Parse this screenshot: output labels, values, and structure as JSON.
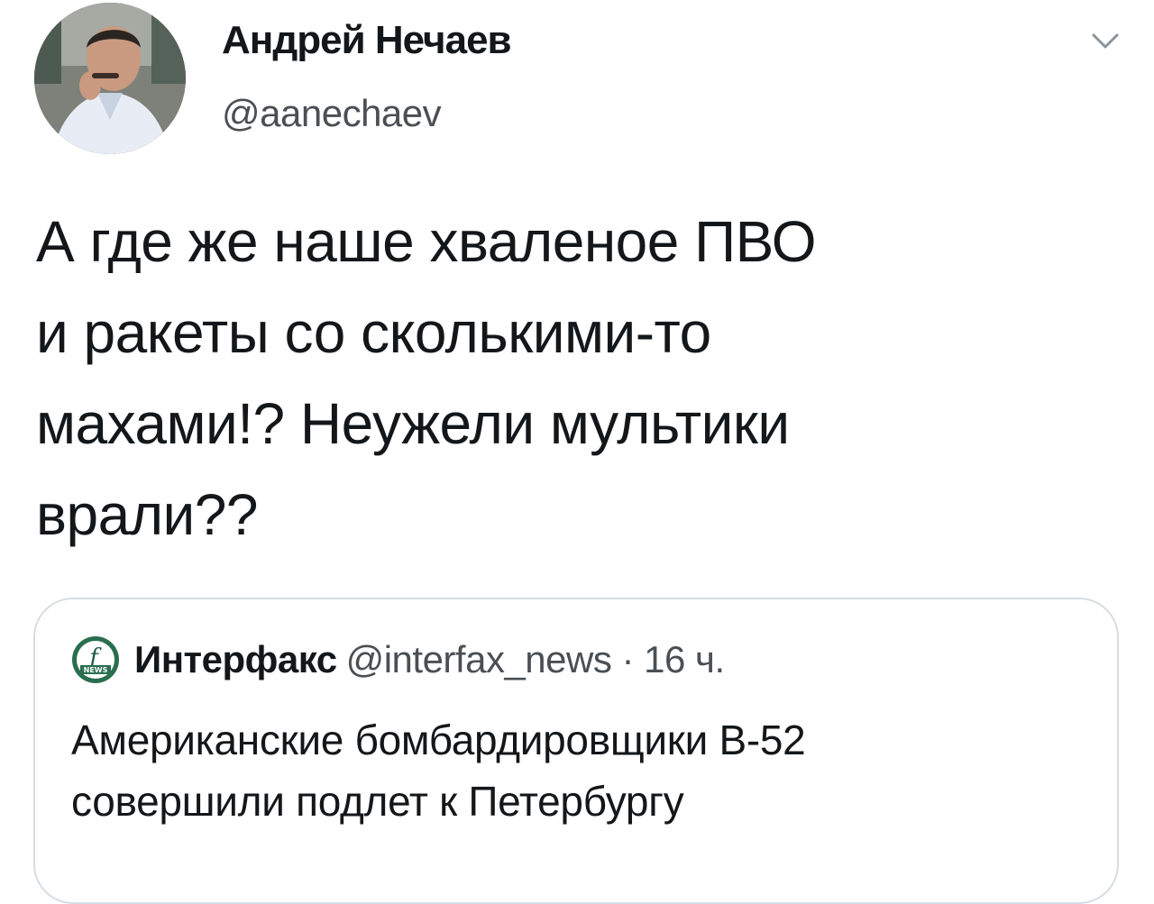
{
  "tweet": {
    "author": {
      "display_name": "Андрей Нечаев",
      "handle": "@aanechaev",
      "avatar_icon": "user-avatar"
    },
    "menu_icon": "chevron-down-icon",
    "text_lines": [
      "А где же наше хваленое ПВО",
      "и ракеты со сколькими-то",
      "махами!? Неужели мультики",
      "врали??"
    ]
  },
  "quoted_tweet": {
    "logo_icon": "interfax-news-logo",
    "author_name": "Интерфакс",
    "meta": "@interfax_news · 16 ч.",
    "text_lines": [
      "Американские бомбардировщики B-52",
      "совершили подлет к Петербургу"
    ]
  },
  "colors": {
    "text_primary": "#14171a",
    "text_secondary": "#4a4f54",
    "border": "#d6dde3",
    "interfax_logo": "#2a6e4f"
  }
}
